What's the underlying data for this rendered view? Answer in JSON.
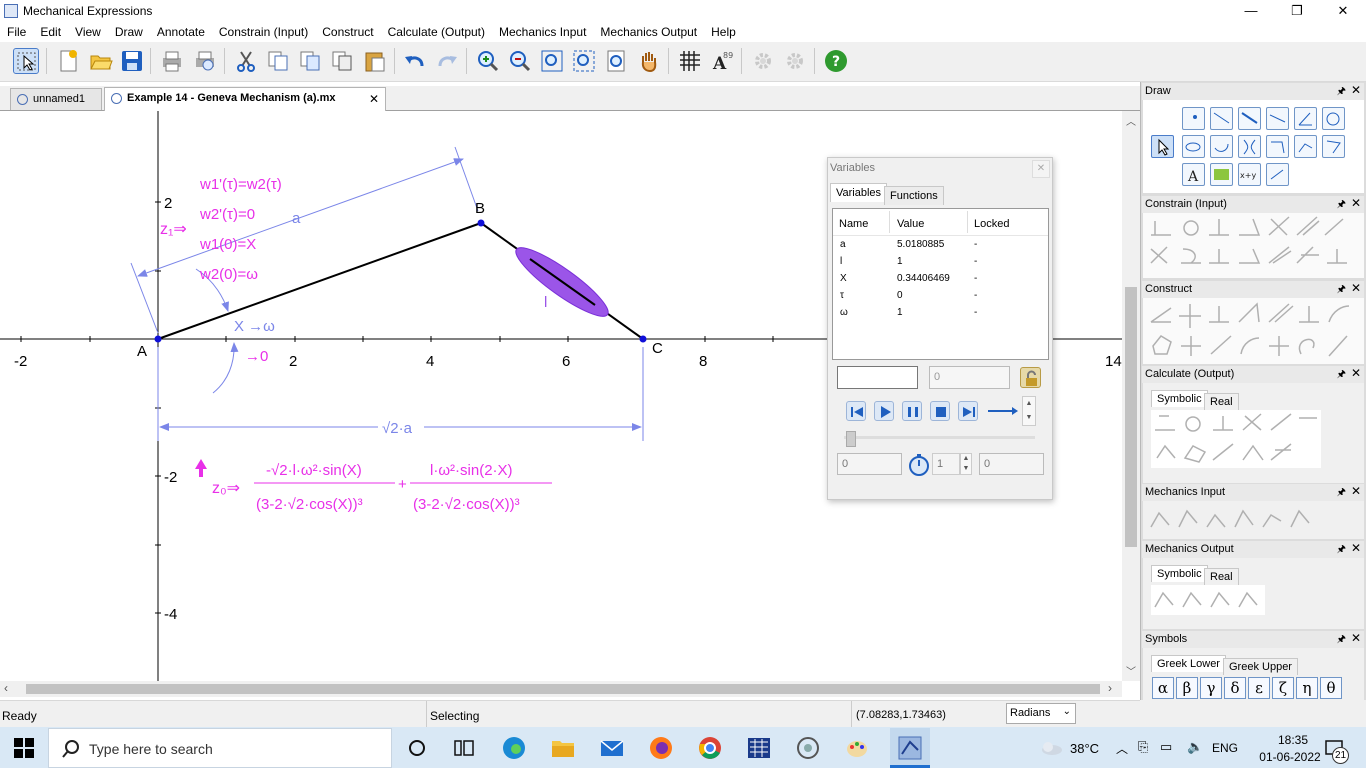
{
  "window": {
    "title": "Mechanical Expressions",
    "minimize": "—",
    "restore": "❐",
    "close": "✕"
  },
  "menu": [
    "File",
    "Edit",
    "View",
    "Draw",
    "Annotate",
    "Constrain (Input)",
    "Construct",
    "Calculate (Output)",
    "Mechanics Input",
    "Mechanics Output",
    "Help"
  ],
  "tabs": [
    {
      "label": "unnamed1",
      "active": false
    },
    {
      "label": "Example 14 - Geneva Mechanism (a).mx",
      "active": true,
      "close": "✕"
    }
  ],
  "canvas": {
    "x_ticks": [
      "-2",
      "2",
      "4",
      "6",
      "8",
      "14"
    ],
    "y_ticks": [
      "2",
      "-2",
      "-4"
    ],
    "points": [
      "A",
      "B",
      "C"
    ],
    "link_label": "l",
    "dim_a": "a",
    "dim_sqrt": "√2·a",
    "z1_label": "z₁⇒",
    "z1_lines": [
      "w1'(τ)=w2(τ)",
      "w2'(τ)=0",
      "w1(0)=X",
      "w2(0)=ω"
    ],
    "angle_label": "X →ω",
    "angle_zero": "→0",
    "z0_label": "z₀⇒",
    "z0_num1": "-√2·l·ω²·sin(X)",
    "z0_den1": "(3-2·√2·cos(X))³",
    "z0_plus": "+",
    "z0_num2": "l·ω²·sin(2·X)",
    "z0_den2": "(3-2·√2·cos(X))³"
  },
  "colors": {
    "magenta": "#e830e8",
    "dim": "#7b86e8",
    "purple": "#9b55e8",
    "point": "#1010d8"
  },
  "variables": {
    "title": "Variables",
    "tabs": [
      "Variables",
      "Functions"
    ],
    "columns": [
      "Name",
      "Value",
      "Locked"
    ],
    "rows": [
      {
        "name": "a",
        "value": "5.0180885",
        "locked": "-"
      },
      {
        "name": "l",
        "value": "1",
        "locked": "-"
      },
      {
        "name": "X",
        "value": "0.34406469",
        "locked": "-"
      },
      {
        "name": "τ",
        "value": "0",
        "locked": "-"
      },
      {
        "name": "ω",
        "value": "1",
        "locked": "-"
      }
    ],
    "input_value": "",
    "input_right": "0",
    "sim_start": "0",
    "sim_step": "1",
    "sim_end": "0"
  },
  "panels": {
    "draw": "Draw",
    "constrain": "Constrain (Input)",
    "construct": "Construct",
    "calculate": "Calculate (Output)",
    "calc_tabs": [
      "Symbolic",
      "Real"
    ],
    "mech_input": "Mechanics Input",
    "mech_output": "Mechanics Output",
    "mech_tabs": [
      "Symbolic",
      "Real"
    ],
    "symbols": "Symbols",
    "symbol_tabs": [
      "Greek Lower",
      "Greek Upper"
    ],
    "greek": [
      "α",
      "β",
      "γ",
      "δ",
      "ε",
      "ζ",
      "η",
      "θ"
    ]
  },
  "status": {
    "ready": "Ready",
    "mode": "Selecting",
    "coords": "(7.08283,1.73463)",
    "units": "Radians"
  },
  "taskbar": {
    "search_placeholder": "Type here to search",
    "weather": "38°C",
    "lang": "ENG",
    "time": "18:35",
    "date": "01-06-2022",
    "notifications": "21"
  }
}
